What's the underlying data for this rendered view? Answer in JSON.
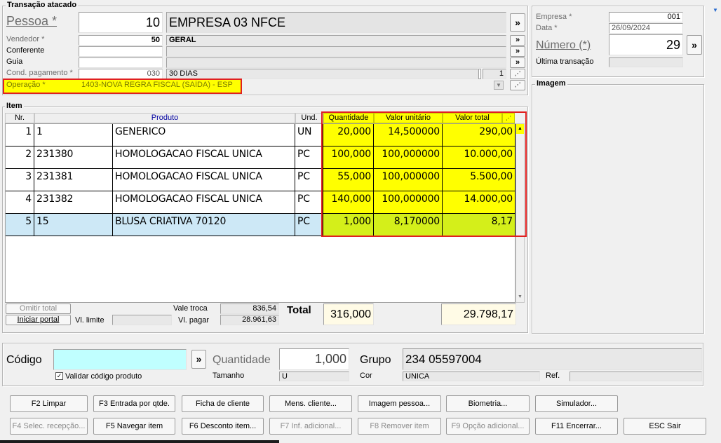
{
  "transacao": {
    "legend": "Transação atacado",
    "pessoa_label": "Pessoa *",
    "pessoa_code": "10",
    "pessoa_name": "EMPRESA 03 NFCE",
    "vendedor_label": "Vendedor *",
    "vendedor_code": "50",
    "vendedor_name": "GERAL",
    "conferente_label": "Conferente",
    "guia_label": "Guia",
    "cond_label": "Cond. pagamento *",
    "cond_code": "030",
    "cond_name": "30 DIAS",
    "cond_parcelas": "1",
    "operacao_label": "Operação *",
    "operacao_value": "1403-NOVA REGRA FISCAL (SAÍDA) - ESP",
    "more_glyph": "»"
  },
  "empresa": {
    "empresa_label": "Empresa *",
    "empresa_value": "001",
    "data_label": "Data *",
    "data_value": "26/09/2024",
    "numero_label": "Número (*)",
    "numero_value": "29",
    "ultima_label": "Última transação",
    "imagem_legend": "Imagem"
  },
  "item": {
    "legend": "Item",
    "columns": [
      "Nr.",
      "Produto",
      "Und.",
      "Quantidade",
      "Valor unitário",
      "Valor total"
    ],
    "rows": [
      {
        "nr": "1",
        "codigo": "1",
        "produto": "GENERICO",
        "und": "UN",
        "qtd": "20,000",
        "unit": "14,500000",
        "total": "290,00"
      },
      {
        "nr": "2",
        "codigo": "231380",
        "produto": "HOMOLOGACAO FISCAL UNICA",
        "und": "PC",
        "qtd": "100,000",
        "unit": "100,000000",
        "total": "10.000,00"
      },
      {
        "nr": "3",
        "codigo": "231381",
        "produto": "HOMOLOGACAO FISCAL UNICA",
        "und": "PC",
        "qtd": "55,000",
        "unit": "100,000000",
        "total": "5.500,00"
      },
      {
        "nr": "4",
        "codigo": "231382",
        "produto": "HOMOLOGACAO FISCAL UNICA",
        "und": "PC",
        "qtd": "140,000",
        "unit": "100,000000",
        "total": "14.000,00"
      },
      {
        "nr": "5",
        "codigo": "15",
        "produto": "BLUSA CRIATIVA 70120",
        "und": "PC",
        "qtd": "1,000",
        "unit": "8,170000",
        "total": "8,17"
      }
    ]
  },
  "totais": {
    "omitir_label": "Omitir total",
    "iniciar_label": "Iniciar portal",
    "vl_limite_label": "Vl. limite",
    "vale_troca_label": "Vale troca",
    "vale_troca_value": "836,54",
    "vl_pagar_label": "Vl. pagar",
    "vl_pagar_value": "28.961,63",
    "total_label": "Total",
    "total_qtd": "316,000",
    "total_valor": "29.798,17"
  },
  "codigo": {
    "codigo_label": "Código",
    "codigo_value": "",
    "validar_label": "Validar código produto",
    "quantidade_label": "Quantidade",
    "quantidade_value": "1,000",
    "tamanho_label": "Tamanho",
    "tamanho_value": "U",
    "grupo_label": "Grupo",
    "grupo_value": "234 05597004",
    "cor_label": "Cor",
    "cor_value": "UNICA",
    "ref_label": "Ref."
  },
  "buttons": {
    "f2": "F2 Limpar",
    "f3": "F3 Entrada por qtde.",
    "ficha": "Ficha de cliente",
    "mens": "Mens. cliente...",
    "imagem": "Imagem pessoa...",
    "biometria": "Biometria...",
    "simulador": "Simulador...",
    "f4": "F4 Selec. recepção...",
    "f5": "F5 Navegar item",
    "f6": "F6 Desconto item...",
    "f7": "F7 Inf. adicional...",
    "f8": "F8 Remover item",
    "f9": "F9 Opção adicional...",
    "f11": "F11 Encerrar...",
    "esc": "ESC Sair"
  },
  "colors": {
    "highlight_yellow": "#ffff00",
    "selected_row": "#cde8f6",
    "annotation_red": "#e02020",
    "codigo_input": "#c0ffff"
  }
}
